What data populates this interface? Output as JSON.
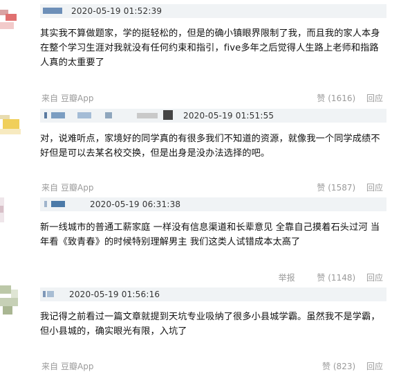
{
  "comments": [
    {
      "time": "2020-05-19 01:52:39",
      "text": "其实我不算做题家，学的挺轻松的，但是的确小镇眼界限制了我，而且我的家人本身在整个学习生涯对我就没有任何约束和指引，five多年之后觉得人生路上老师和指路人真的太重要了",
      "source_prefix": "来自",
      "source_app": "豆瓣App",
      "like_label": "赞",
      "like_count": "(1616)",
      "reply_label": "回应"
    },
    {
      "time": "2020-05-19 01:51:55",
      "text": "对，说难听点，家境好的同学真的有很多我们不知道的资源，就像我一个同学成绩不好但是可以去某名校交换，但是出身是没办法选择的吧。",
      "source_prefix": "来自",
      "source_app": "豆瓣App",
      "like_label": "赞",
      "like_count": "(1587)",
      "reply_label": "回应"
    },
    {
      "time": "2020-05-19 06:31:38",
      "text": "新一线城市的普通工薪家庭 一样没有信息渠道和长辈意见 全靠自己摸着石头过河 当年看《致青春》的时候特别理解男主 我们这类人试错成本太高了",
      "report_label": "举报",
      "like_label": "赞",
      "like_count": "(1148)",
      "reply_label": "回应"
    },
    {
      "time": "2020-05-19 01:56:16",
      "text": "我记得之前看过一篇文章就提到天坑专业吸纳了很多小县城学霸。虽然我不是学霸，但小县城的，确实眼光有限，入坑了",
      "source_prefix": "来自",
      "source_app": "豆瓣App",
      "like_label": "赞",
      "like_count": "(823)",
      "reply_label": "回应"
    }
  ]
}
